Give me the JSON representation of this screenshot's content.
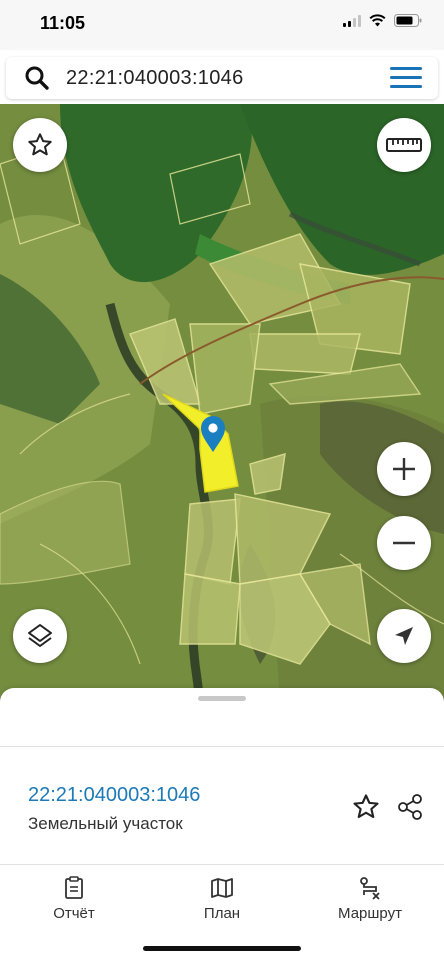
{
  "status_bar": {
    "time": "11:05"
  },
  "search": {
    "value": "22:21:040003:1046"
  },
  "map": {
    "buttons": [
      "favorite-icon",
      "ruler-icon",
      "zoom-in-icon",
      "zoom-out-icon",
      "layers-icon",
      "locate-icon"
    ]
  },
  "sheet": {
    "parcel_id": "22:21:040003:1046",
    "parcel_type": "Земельный участок"
  },
  "tabs": [
    {
      "label": "Отчёт",
      "icon": "report-icon"
    },
    {
      "label": "План",
      "icon": "map-icon"
    },
    {
      "label": "Маршрут",
      "icon": "route-icon"
    }
  ],
  "colors": {
    "accent": "#1d7ab8",
    "parcel_fill": "#f3ee2a",
    "parcel_outline": "#e8e79a",
    "marker": "#1a7fc1"
  }
}
